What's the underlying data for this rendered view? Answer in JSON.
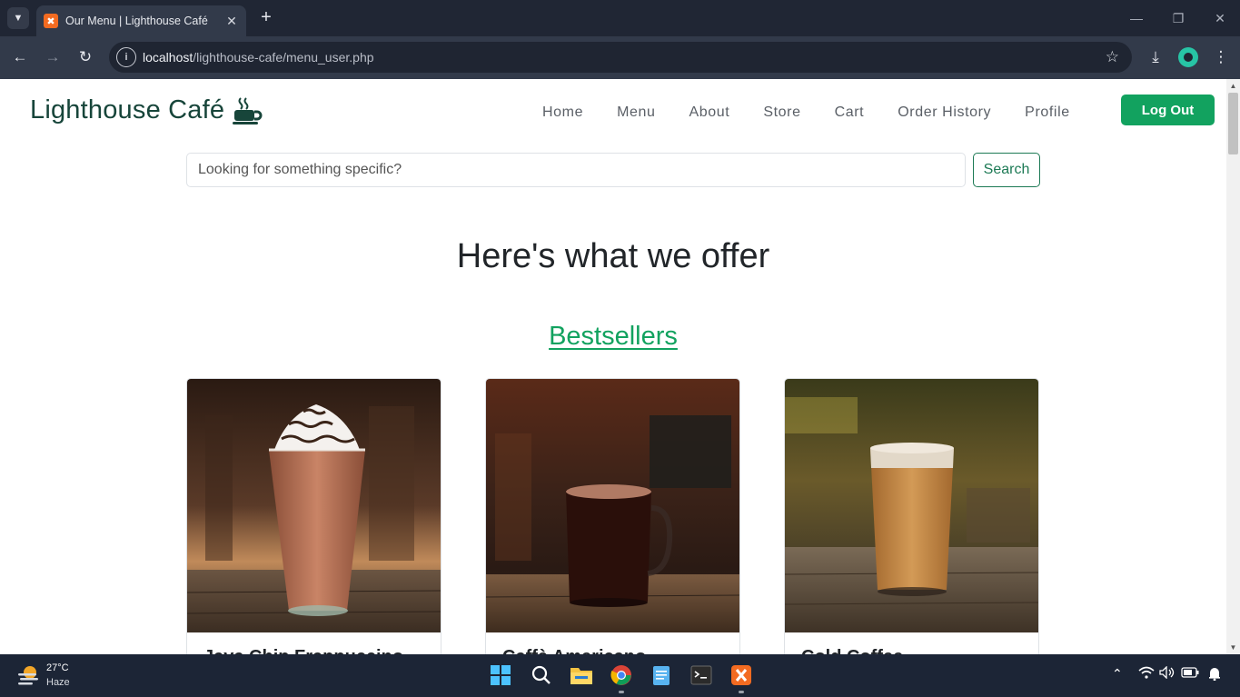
{
  "browser": {
    "tab_title": "Our Menu | Lighthouse Café",
    "tab_favicon": "xampp-icon",
    "url_host": "localhost",
    "url_path": "/lighthouse-cafe/menu_user.php"
  },
  "site": {
    "brand": "Lighthouse Café",
    "nav": [
      "Home",
      "Menu",
      "About",
      "Store",
      "Cart",
      "Order History",
      "Profile"
    ],
    "logout_label": "Log Out"
  },
  "search": {
    "placeholder": "Looking for something specific?",
    "button_label": "Search"
  },
  "main": {
    "heading": "Here's what we offer",
    "section_title": "Bestsellers",
    "cards": [
      {
        "name": "Java Chip Frappuccino",
        "image": "frappuccino-drink-image"
      },
      {
        "name": "Caffè Americano",
        "image": "americano-mug-image"
      },
      {
        "name": "Cold Coffee",
        "image": "cold-coffee-glass-image"
      }
    ]
  },
  "taskbar": {
    "temperature": "27°C",
    "weather": "Haze",
    "apps": [
      "start-icon",
      "search-icon",
      "file-explorer-icon",
      "chrome-icon",
      "notepad-icon",
      "terminal-icon",
      "xampp-icon"
    ]
  },
  "colors": {
    "accent": "#12a25f",
    "brand_text": "#17453a",
    "chrome_dark": "#202634",
    "taskbar": "#1c2536"
  }
}
